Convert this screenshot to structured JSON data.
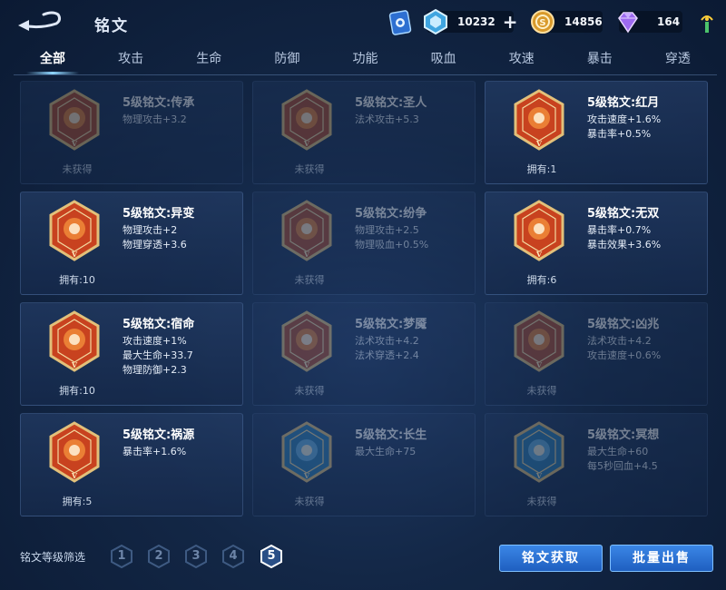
{
  "header": {
    "title": "铭文",
    "back_icon": "back-arrow-icon",
    "resources": [
      {
        "name": "diamond",
        "icon": "diamond-icon",
        "value": "10232",
        "has_plus": true
      },
      {
        "name": "gold",
        "icon": "gold-coin-icon",
        "value": "14856"
      },
      {
        "name": "gem",
        "icon": "purple-gem-icon",
        "value": "164"
      }
    ]
  },
  "tabs": [
    {
      "label": "全部",
      "active": true
    },
    {
      "label": "攻击"
    },
    {
      "label": "生命"
    },
    {
      "label": "防御"
    },
    {
      "label": "功能"
    },
    {
      "label": "吸血"
    },
    {
      "label": "攻速"
    },
    {
      "label": "暴击"
    },
    {
      "label": "穿透"
    }
  ],
  "inscriptions": [
    {
      "name": "5级铭文:传承",
      "attrs": [
        "物理攻击+3.2"
      ],
      "status": "未获得",
      "owned": false,
      "color": "#b04a2a",
      "icon": "pillars-icon"
    },
    {
      "name": "5级铭文:圣人",
      "attrs": [
        "法术攻击+5.3"
      ],
      "status": "未获得",
      "owned": false,
      "color": "#b04a2a",
      "icon": "crossed-blades-icon"
    },
    {
      "name": "5级铭文:红月",
      "attrs": [
        "攻击速度+1.6%",
        "暴击率+0.5%"
      ],
      "status": "拥有:1",
      "owned": true,
      "color": "#c8421f",
      "icon": "crescent-moon-icon"
    },
    {
      "name": "5级铭文:异变",
      "attrs": [
        "物理攻击+2",
        "物理穿透+3.6"
      ],
      "status": "拥有:10",
      "owned": true,
      "color": "#c8421f",
      "icon": "mask-icon"
    },
    {
      "name": "5级铭文:纷争",
      "attrs": [
        "物理攻击+2.5",
        "物理吸血+0.5%"
      ],
      "status": "未获得",
      "owned": false,
      "color": "#b04a2a",
      "icon": "axe-icon"
    },
    {
      "name": "5级铭文:无双",
      "attrs": [
        "暴击率+0.7%",
        "暴击效果+3.6%"
      ],
      "status": "拥有:6",
      "owned": true,
      "color": "#c8421f",
      "icon": "swirl-diamond-icon"
    },
    {
      "name": "5级铭文:宿命",
      "attrs": [
        "攻击速度+1%",
        "最大生命+33.7",
        "物理防御+2.3"
      ],
      "status": "拥有:10",
      "owned": true,
      "color": "#c8421f",
      "icon": "flame-icon"
    },
    {
      "name": "5级铭文:梦魇",
      "attrs": [
        "法术攻击+4.2",
        "法术穿透+2.4"
      ],
      "status": "未获得",
      "owned": false,
      "color": "#b04a2a",
      "icon": "flame-crown-icon"
    },
    {
      "name": "5级铭文:凶兆",
      "attrs": [
        "法术攻击+4.2",
        "攻击速度+0.6%"
      ],
      "status": "未获得",
      "owned": false,
      "color": "#b04a2a",
      "icon": "gem-icon"
    },
    {
      "name": "5级铭文:祸源",
      "attrs": [
        "暴击率+1.6%"
      ],
      "status": "拥有:5",
      "owned": true,
      "color": "#c8421f",
      "icon": "fan-icon"
    },
    {
      "name": "5级铭文:长生",
      "attrs": [
        "最大生命+75"
      ],
      "status": "未获得",
      "owned": false,
      "color": "#2a7ab0",
      "icon": "whale-tail-icon"
    },
    {
      "name": "5级铭文:冥想",
      "attrs": [
        "最大生命+60",
        "每5秒回血+4.5"
      ],
      "status": "未获得",
      "owned": false,
      "color": "#2a7ab0",
      "icon": "web-star-icon"
    }
  ],
  "footer": {
    "filter_label": "铭文等级筛选",
    "levels": [
      {
        "label": "1",
        "active": false
      },
      {
        "label": "2",
        "active": false
      },
      {
        "label": "3",
        "active": false
      },
      {
        "label": "4",
        "active": false
      },
      {
        "label": "5",
        "active": true
      }
    ],
    "acquire_button": "铭文获取",
    "sell_button": "批量出售"
  }
}
